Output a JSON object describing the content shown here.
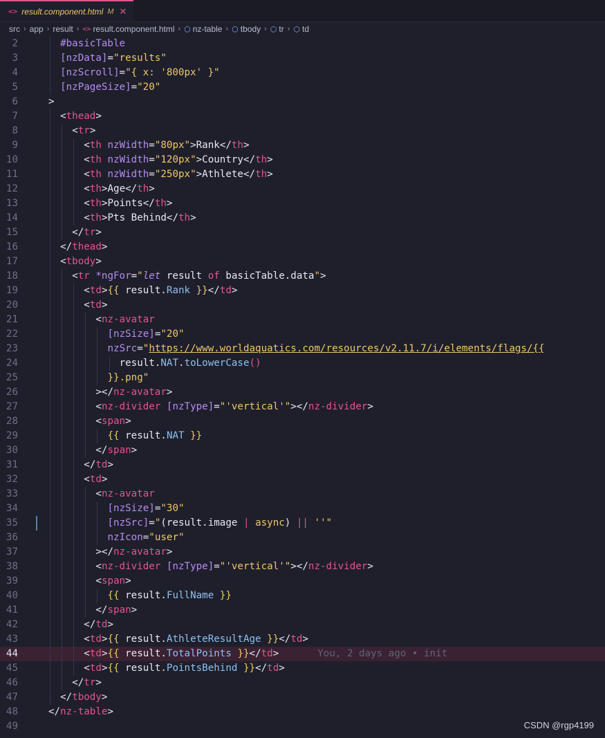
{
  "tab": {
    "filename": "result.component.html",
    "modified": "M",
    "close": "✕"
  },
  "breadcrumb": [
    "src",
    "app",
    "result",
    "result.component.html",
    "nz-table",
    "tbody",
    "tr",
    "td"
  ],
  "lines": [
    {
      "n": "2",
      "indent": 1,
      "html": "<span class='t-attr'>#basicTable</span>"
    },
    {
      "n": "3",
      "indent": 1,
      "html": "<span class='t-attr'>[nzData]</span><span class='t-ang'>=</span><span class='t-str'>\"results\"</span>"
    },
    {
      "n": "4",
      "indent": 1,
      "html": "<span class='t-attr'>[nzScroll]</span><span class='t-ang'>=</span><span class='t-str'>\"{ x: '800px' }\"</span>"
    },
    {
      "n": "5",
      "indent": 1,
      "html": "<span class='t-attr'>[nzPageSize]</span><span class='t-ang'>=</span><span class='t-str'>\"20\"</span>"
    },
    {
      "n": "6",
      "indent": 0,
      "html": "<span class='t-ang'>&gt;</span>"
    },
    {
      "n": "7",
      "indent": 1,
      "html": "<span class='t-ang'>&lt;</span><span class='t-tag'>thead</span><span class='t-ang'>&gt;</span>"
    },
    {
      "n": "8",
      "indent": 2,
      "html": "<span class='t-ang'>&lt;</span><span class='t-tag'>tr</span><span class='t-ang'>&gt;</span>"
    },
    {
      "n": "9",
      "indent": 3,
      "html": "<span class='t-ang'>&lt;</span><span class='t-tag'>th</span> <span class='t-attr'>nzWidth</span><span class='t-ang'>=</span><span class='t-str'>\"80px\"</span><span class='t-ang'>&gt;</span><span class='t-txt'>Rank</span><span class='t-ang'>&lt;/</span><span class='t-tag'>th</span><span class='t-ang'>&gt;</span>"
    },
    {
      "n": "10",
      "indent": 3,
      "html": "<span class='t-ang'>&lt;</span><span class='t-tag'>th</span> <span class='t-attr'>nzWidth</span><span class='t-ang'>=</span><span class='t-str'>\"120px\"</span><span class='t-ang'>&gt;</span><span class='t-txt'>Country</span><span class='t-ang'>&lt;/</span><span class='t-tag'>th</span><span class='t-ang'>&gt;</span>"
    },
    {
      "n": "11",
      "indent": 3,
      "html": "<span class='t-ang'>&lt;</span><span class='t-tag'>th</span> <span class='t-attr'>nzWidth</span><span class='t-ang'>=</span><span class='t-str'>\"250px\"</span><span class='t-ang'>&gt;</span><span class='t-txt'>Athlete</span><span class='t-ang'>&lt;/</span><span class='t-tag'>th</span><span class='t-ang'>&gt;</span>"
    },
    {
      "n": "12",
      "indent": 3,
      "html": "<span class='t-ang'>&lt;</span><span class='t-tag'>th</span><span class='t-ang'>&gt;</span><span class='t-txt'>Age</span><span class='t-ang'>&lt;/</span><span class='t-tag'>th</span><span class='t-ang'>&gt;</span>"
    },
    {
      "n": "13",
      "indent": 3,
      "html": "<span class='t-ang'>&lt;</span><span class='t-tag'>th</span><span class='t-ang'>&gt;</span><span class='t-txt'>Points</span><span class='t-ang'>&lt;/</span><span class='t-tag'>th</span><span class='t-ang'>&gt;</span>"
    },
    {
      "n": "14",
      "indent": 3,
      "html": "<span class='t-ang'>&lt;</span><span class='t-tag'>th</span><span class='t-ang'>&gt;</span><span class='t-txt'>Pts Behind</span><span class='t-ang'>&lt;/</span><span class='t-tag'>th</span><span class='t-ang'>&gt;</span>"
    },
    {
      "n": "15",
      "indent": 2,
      "html": "<span class='t-ang'>&lt;/</span><span class='t-tag'>tr</span><span class='t-ang'>&gt;</span>"
    },
    {
      "n": "16",
      "indent": 1,
      "html": "<span class='t-ang'>&lt;/</span><span class='t-tag'>thead</span><span class='t-ang'>&gt;</span>"
    },
    {
      "n": "17",
      "indent": 1,
      "html": "<span class='t-ang'>&lt;</span><span class='t-tag'>tbody</span><span class='t-ang'>&gt;</span>"
    },
    {
      "n": "18",
      "indent": 2,
      "html": "<span class='t-ang'>&lt;</span><span class='t-tag'>tr</span> <span class='t-attr'>*ngFor</span><span class='t-ang'>=</span><span class='t-str'>\"</span><span class='t-kw'>let</span><span class='t-txt'> result </span><span class='t-op'>of</span><span class='t-txt'> basicTable.data</span><span class='t-str'>\"</span><span class='t-ang'>&gt;</span>"
    },
    {
      "n": "19",
      "indent": 3,
      "html": "<span class='t-ang'>&lt;</span><span class='t-tag'>td</span><span class='t-ang'>&gt;</span><span class='t-brace'>{{</span><span class='t-txt'> result.</span><span class='t-var'>Rank</span> <span class='t-brace'>}}</span><span class='t-ang'>&lt;/</span><span class='t-tag'>td</span><span class='t-ang'>&gt;</span>"
    },
    {
      "n": "20",
      "indent": 3,
      "html": "<span class='t-ang'>&lt;</span><span class='t-tag'>td</span><span class='t-ang'>&gt;</span>"
    },
    {
      "n": "21",
      "indent": 4,
      "html": "<span class='t-ang'>&lt;</span><span class='t-tag'>nz-avatar</span>"
    },
    {
      "n": "22",
      "indent": 5,
      "html": "<span class='t-attr'>[nzSize]</span><span class='t-ang'>=</span><span class='t-str'>\"20\"</span>"
    },
    {
      "n": "23",
      "indent": 5,
      "html": "<span class='t-attr'>nzSrc</span><span class='t-ang'>=</span><span class='t-str'>\"</span><span class='t-url'>https://www.worldaquatics.com/resources/v2.11.7/i/elements/flags/{{</span>"
    },
    {
      "n": "24",
      "indent": 6,
      "html": "<span class='t-txt'>result.</span><span class='t-var'>NAT</span><span class='t-txt'>.</span><span class='t-fn'>toLowerCase</span><span class='t-op'>()</span>"
    },
    {
      "n": "25",
      "indent": 5,
      "html": "<span class='t-brace'>}}</span><span class='t-str'>.png\"</span>"
    },
    {
      "n": "26",
      "indent": 4,
      "html": "<span class='t-ang'>&gt;&lt;/</span><span class='t-tag'>nz-avatar</span><span class='t-ang'>&gt;</span>"
    },
    {
      "n": "27",
      "indent": 4,
      "html": "<span class='t-ang'>&lt;</span><span class='t-tag'>nz-divider</span> <span class='t-attr'>[nzType]</span><span class='t-ang'>=</span><span class='t-str'>\"'vertical'\"</span><span class='t-ang'>&gt;&lt;/</span><span class='t-tag'>nz-divider</span><span class='t-ang'>&gt;</span>"
    },
    {
      "n": "28",
      "indent": 4,
      "html": "<span class='t-ang'>&lt;</span><span class='t-tag'>span</span><span class='t-ang'>&gt;</span>"
    },
    {
      "n": "29",
      "indent": 5,
      "html": "<span class='t-brace'>{{</span><span class='t-txt'> result.</span><span class='t-var'>NAT</span> <span class='t-brace'>}}</span>"
    },
    {
      "n": "30",
      "indent": 4,
      "html": "<span class='t-ang'>&lt;/</span><span class='t-tag'>span</span><span class='t-ang'>&gt;</span>"
    },
    {
      "n": "31",
      "indent": 3,
      "html": "<span class='t-ang'>&lt;/</span><span class='t-tag'>td</span><span class='t-ang'>&gt;</span>"
    },
    {
      "n": "32",
      "indent": 3,
      "html": "<span class='t-ang'>&lt;</span><span class='t-tag'>td</span><span class='t-ang'>&gt;</span>"
    },
    {
      "n": "33",
      "indent": 4,
      "html": "<span class='t-ang'>&lt;</span><span class='t-tag'>nz-avatar</span>"
    },
    {
      "n": "34",
      "indent": 5,
      "html": "<span class='t-attr'>[nzSize]</span><span class='t-ang'>=</span><span class='t-str'>\"30\"</span>"
    },
    {
      "n": "35",
      "indent": 5,
      "scm": true,
      "html": "<span class='t-attr'>[nzSrc]</span><span class='t-ang'>=</span><span class='t-str'>\"</span><span class='t-txt'>(result.image </span><span class='t-op'>|</span><span class='t-txt'> </span><span class='t-str'>async</span><span class='t-txt'>) </span><span class='t-op'>||</span><span class='t-txt'> </span><span class='t-str'>''\"</span>"
    },
    {
      "n": "36",
      "indent": 5,
      "html": "<span class='t-attr'>nzIcon</span><span class='t-ang'>=</span><span class='t-str'>\"user\"</span>"
    },
    {
      "n": "37",
      "indent": 4,
      "html": "<span class='t-ang'>&gt;&lt;/</span><span class='t-tag'>nz-avatar</span><span class='t-ang'>&gt;</span>"
    },
    {
      "n": "38",
      "indent": 4,
      "html": "<span class='t-ang'>&lt;</span><span class='t-tag'>nz-divider</span> <span class='t-attr'>[nzType]</span><span class='t-ang'>=</span><span class='t-str'>\"'vertical'\"</span><span class='t-ang'>&gt;&lt;/</span><span class='t-tag'>nz-divider</span><span class='t-ang'>&gt;</span>"
    },
    {
      "n": "39",
      "indent": 4,
      "html": "<span class='t-ang'>&lt;</span><span class='t-tag'>span</span><span class='t-ang'>&gt;</span>"
    },
    {
      "n": "40",
      "indent": 5,
      "html": "<span class='t-brace'>{{</span><span class='t-txt'> result.</span><span class='t-var'>FullName</span> <span class='t-brace'>}}</span>"
    },
    {
      "n": "41",
      "indent": 4,
      "html": "<span class='t-ang'>&lt;/</span><span class='t-tag'>span</span><span class='t-ang'>&gt;</span>"
    },
    {
      "n": "42",
      "indent": 3,
      "html": "<span class='t-ang'>&lt;/</span><span class='t-tag'>td</span><span class='t-ang'>&gt;</span>"
    },
    {
      "n": "43",
      "indent": 3,
      "html": "<span class='t-ang'>&lt;</span><span class='t-tag'>td</span><span class='t-ang'>&gt;</span><span class='t-brace'>{{</span><span class='t-txt'> result.</span><span class='t-var'>AthleteResultAge</span> <span class='t-brace'>}}</span><span class='t-ang'>&lt;/</span><span class='t-tag'>td</span><span class='t-ang'>&gt;</span>"
    },
    {
      "n": "44",
      "indent": 3,
      "active": true,
      "blame": "You, 2 days ago • init",
      "html": "<span class='t-ang'>&lt;</span><span class='t-tag'>td</span><span class='t-ang'>&gt;</span><span class='t-brace'>{{</span><span class='t-txt'> result.</span><span class='t-var'>TotalPoints</span> <span class='t-brace'>}}</span><span class='t-ang'>&lt;/</span><span class='t-tag'>td</span><span class='t-ang'>&gt;</span>"
    },
    {
      "n": "45",
      "indent": 3,
      "html": "<span class='t-ang'>&lt;</span><span class='t-tag'>td</span><span class='t-ang'>&gt;</span><span class='t-brace'>{{</span><span class='t-txt'> result.</span><span class='t-var'>PointsBehind</span> <span class='t-brace'>}}</span><span class='t-ang'>&lt;/</span><span class='t-tag'>td</span><span class='t-ang'>&gt;</span>"
    },
    {
      "n": "46",
      "indent": 2,
      "html": "<span class='t-ang'>&lt;/</span><span class='t-tag'>tr</span><span class='t-ang'>&gt;</span>"
    },
    {
      "n": "47",
      "indent": 1,
      "html": "<span class='t-ang'>&lt;/</span><span class='t-tag'>tbody</span><span class='t-ang'>&gt;</span>"
    },
    {
      "n": "48",
      "indent": 0,
      "html": "<span class='t-ang'>&lt;/</span><span class='t-tag'>nz-table</span><span class='t-ang'>&gt;</span>"
    },
    {
      "n": "49",
      "indent": 0,
      "html": ""
    }
  ],
  "watermark": "CSDN @rgp4199"
}
